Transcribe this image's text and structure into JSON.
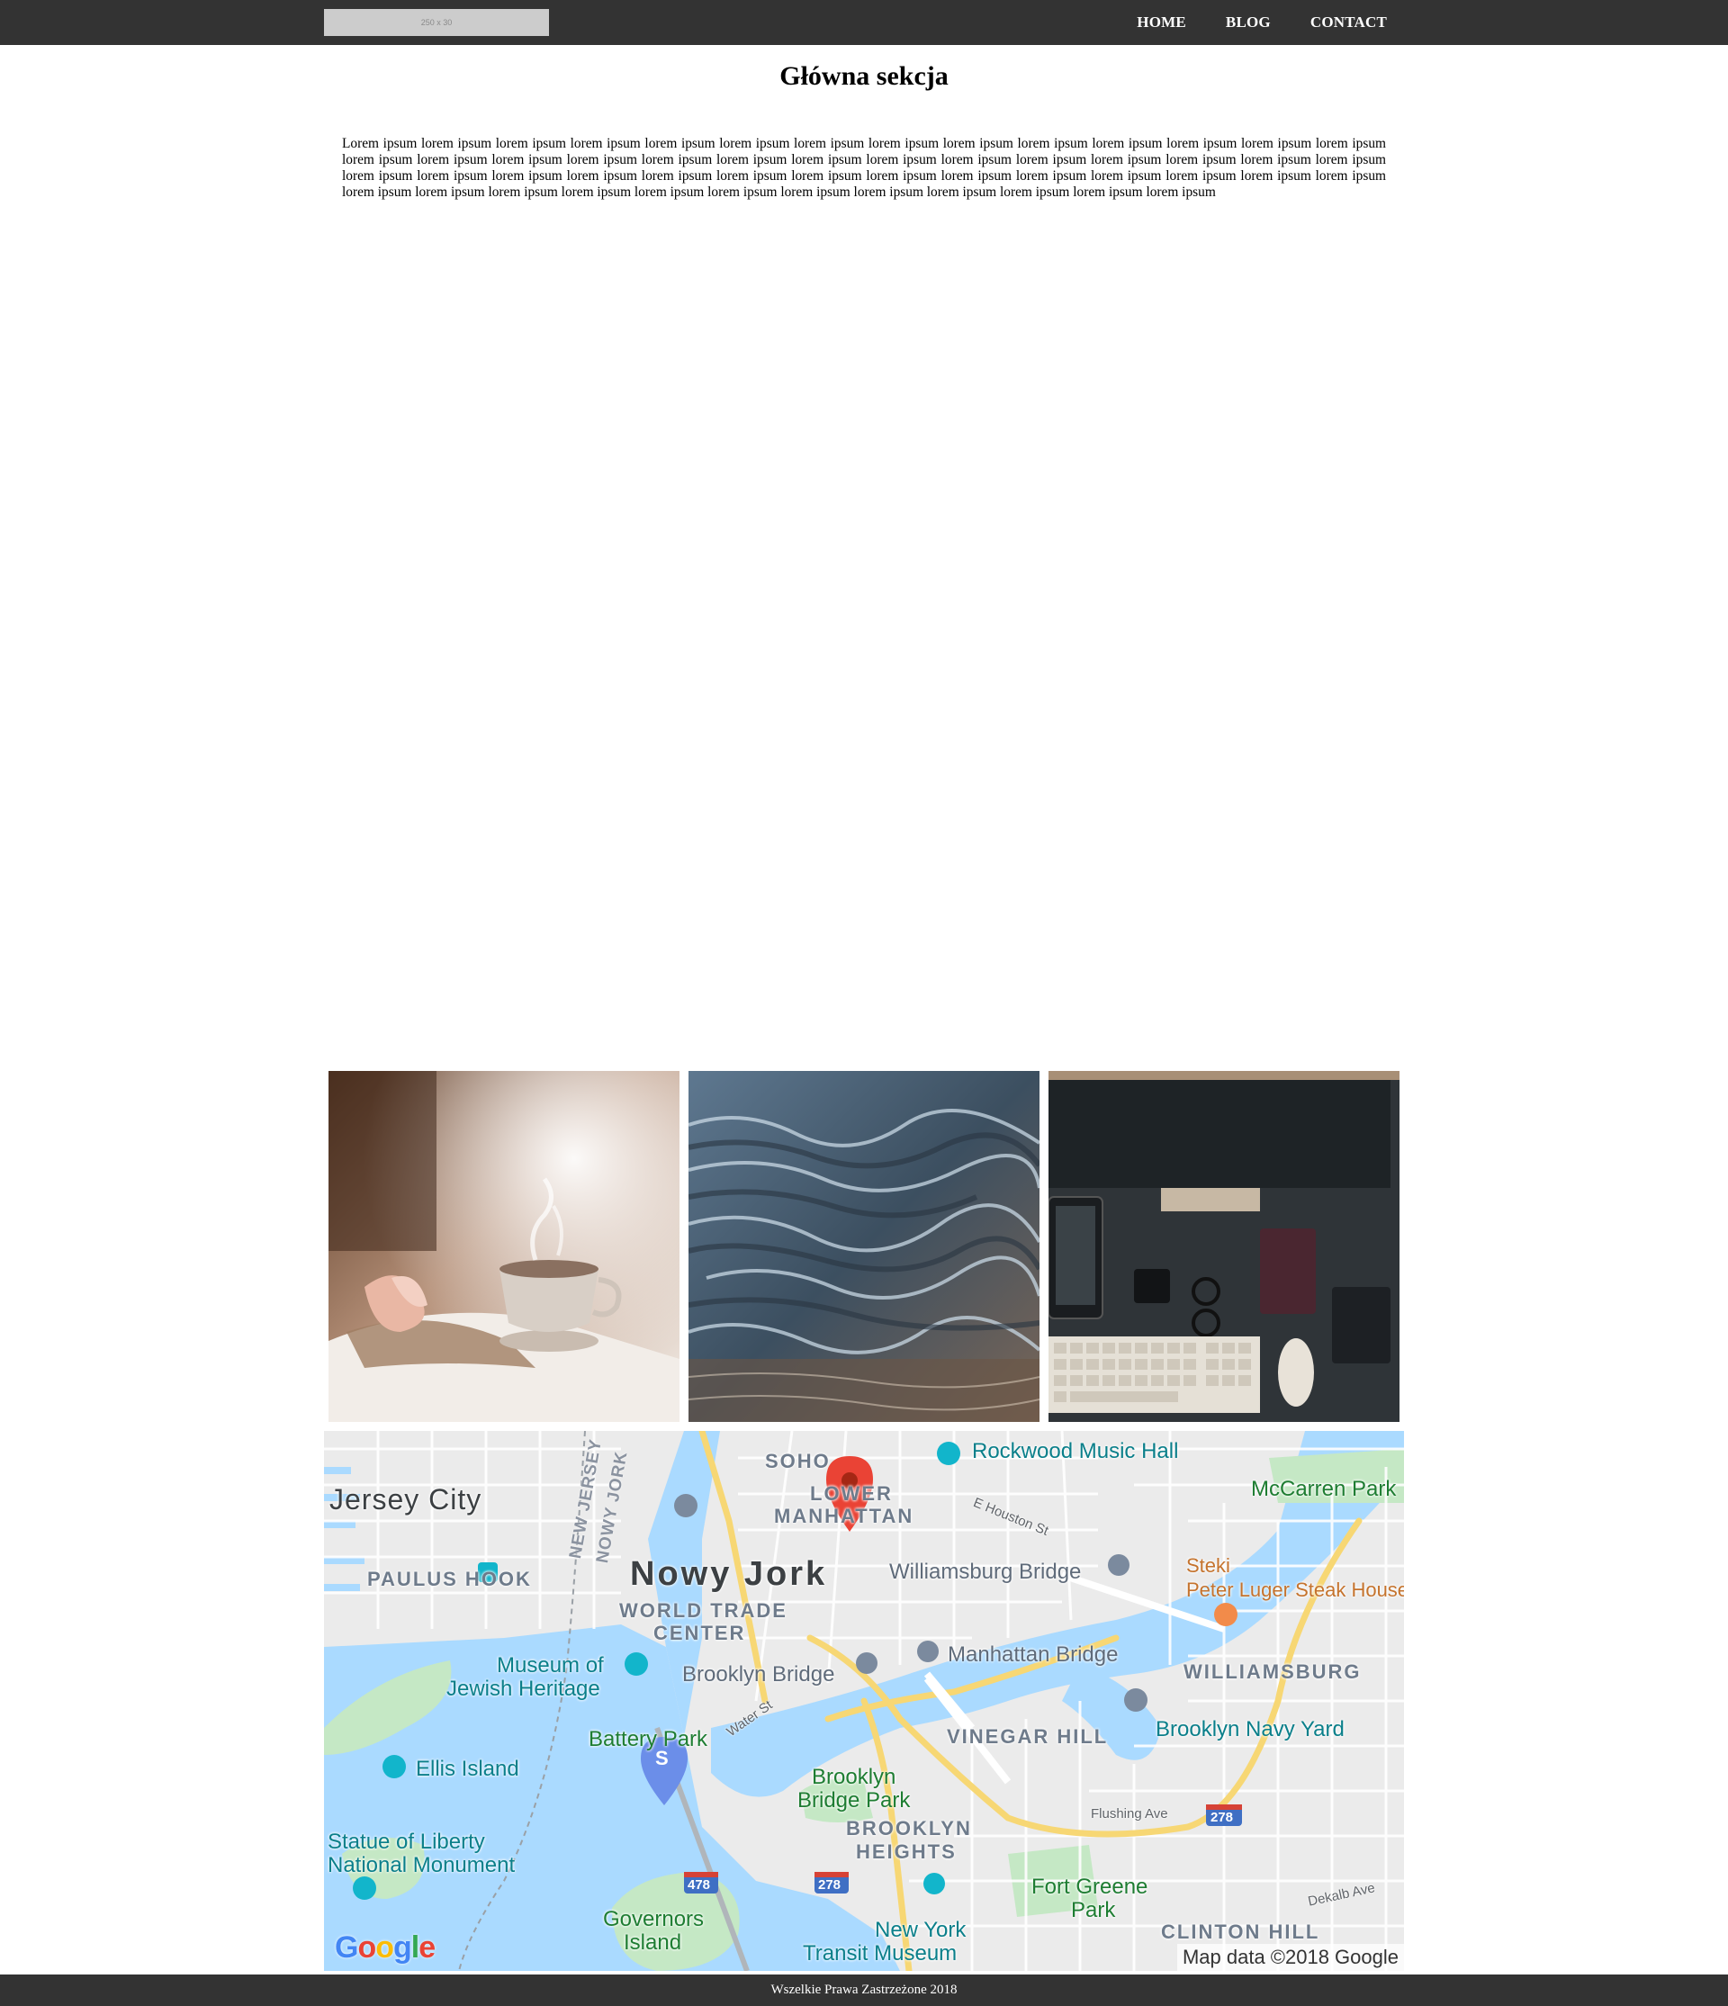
{
  "header": {
    "logo_text": "250 x 30",
    "nav": [
      {
        "label": "HOME"
      },
      {
        "label": "BLOG"
      },
      {
        "label": "CONTACT"
      }
    ]
  },
  "main": {
    "title": "Główna sekcja",
    "text": "Lorem ipsum lorem ipsum lorem ipsum lorem ipsum lorem ipsum lorem ipsum lorem ipsum lorem ipsum lorem ipsum lorem ipsum lorem ipsum lorem ipsum lorem ipsum lorem ipsum lorem ipsum lorem ipsum lorem ipsum lorem ipsum lorem ipsum lorem ipsum lorem ipsum lorem ipsum lorem ipsum lorem ipsum lorem ipsum lorem ipsum lorem ipsum lorem ipsum lorem ipsum lorem ipsum lorem ipsum lorem ipsum lorem ipsum lorem ipsum lorem ipsum lorem ipsum lorem ipsum lorem ipsum lorem ipsum lorem ipsum lorem ipsum lorem ipsum lorem ipsum lorem ipsum lorem ipsum lorem ipsum lorem ipsum lorem ipsum lorem ipsum lorem ipsum lorem ipsum lorem ipsum lorem ipsum lorem ipsum"
  },
  "gallery": {
    "images": [
      {
        "subject": "tea cup and open book"
      },
      {
        "subject": "water surface"
      },
      {
        "subject": "desk with keyboard and monitor"
      }
    ]
  },
  "map": {
    "labels": {
      "jersey_city": "Jersey City",
      "paulus_hook": "PAULUS HOOK",
      "new_jersey": "NEW JERSEY",
      "nowy_jork_state": "NOWY JORK",
      "nowy_jork": "Nowy Jork",
      "soho": "SOHO",
      "lower_manhattan_1": "LOWER",
      "lower_manhattan_2": "MANHATTAN",
      "rockwood": "Rockwood Music Hall",
      "e_houston": "E Houston St",
      "mccarren": "McCarren Park",
      "williamsburg_bridge": "Williamsburg Bridge",
      "steki": "Steki",
      "peter_luger": "Peter Luger Steak House",
      "wtc_1": "WORLD TRADE",
      "wtc_2": "CENTER",
      "williamsburg": "WILLIAMSBURG",
      "museum_1": "Museum of",
      "museum_2": "Jewish Heritage",
      "brooklyn_bridge": "Brooklyn Bridge",
      "manhattan_bridge": "Manhattan Bridge",
      "water_st": "Water St",
      "battery_park": "Battery Park",
      "vinegar_hill": "VINEGAR HILL",
      "navy_yard": "Brooklyn Navy Yard",
      "ellis_island": "Ellis Island",
      "bb_park_1": "Brooklyn",
      "bb_park_2": "Bridge Park",
      "bk_heights_1": "BROOKLYN",
      "bk_heights_2": "HEIGHTS",
      "flushing": "Flushing Ave",
      "liberty_1": "Statue of Liberty",
      "liberty_2": "National Monument",
      "fort_greene_1": "Fort Greene",
      "fort_greene_2": "Park",
      "dekalb": "Dekalb Ave",
      "governors_1": "Governors",
      "governors_2": "Island",
      "transit_1": "New York",
      "transit_2": "Transit Museum",
      "clinton_hill": "CLINTON HILL",
      "hwy_478_a": "478",
      "hwy_478_b": "478",
      "hwy_278_a": "278",
      "hwy_278_b": "278",
      "pin_s": "S"
    },
    "google_logo": [
      "G",
      "o",
      "o",
      "g",
      "l",
      "e"
    ],
    "attribution": "Map data ©2018 Google"
  },
  "footer": {
    "text": "Wszelkie Prawa Zastrzeżone 2018"
  }
}
